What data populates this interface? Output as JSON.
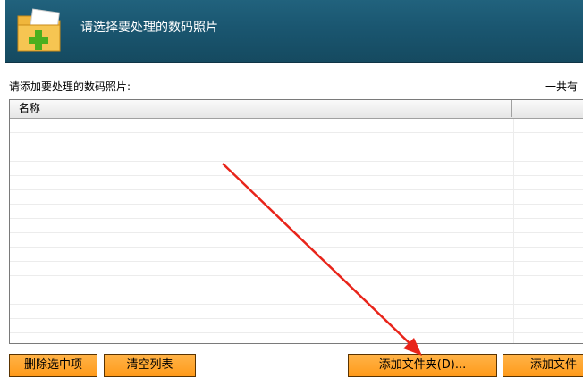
{
  "header": {
    "title": "请选择要处理的数码照片",
    "icon": "folder-add-icon"
  },
  "prompt": "请添加要处理的数码照片:",
  "total_label": "一共有",
  "list": {
    "columns": [
      "名称",
      ""
    ]
  },
  "buttons": {
    "delete_selected": "删除选中项",
    "clear_list": "清空列表",
    "add_folder": "添加文件夹(D)...",
    "add_file": "添加文件"
  },
  "colors": {
    "header_bg": "#1a5670",
    "button_bg": "#ff9a1a",
    "arrow": "#e8241a"
  }
}
